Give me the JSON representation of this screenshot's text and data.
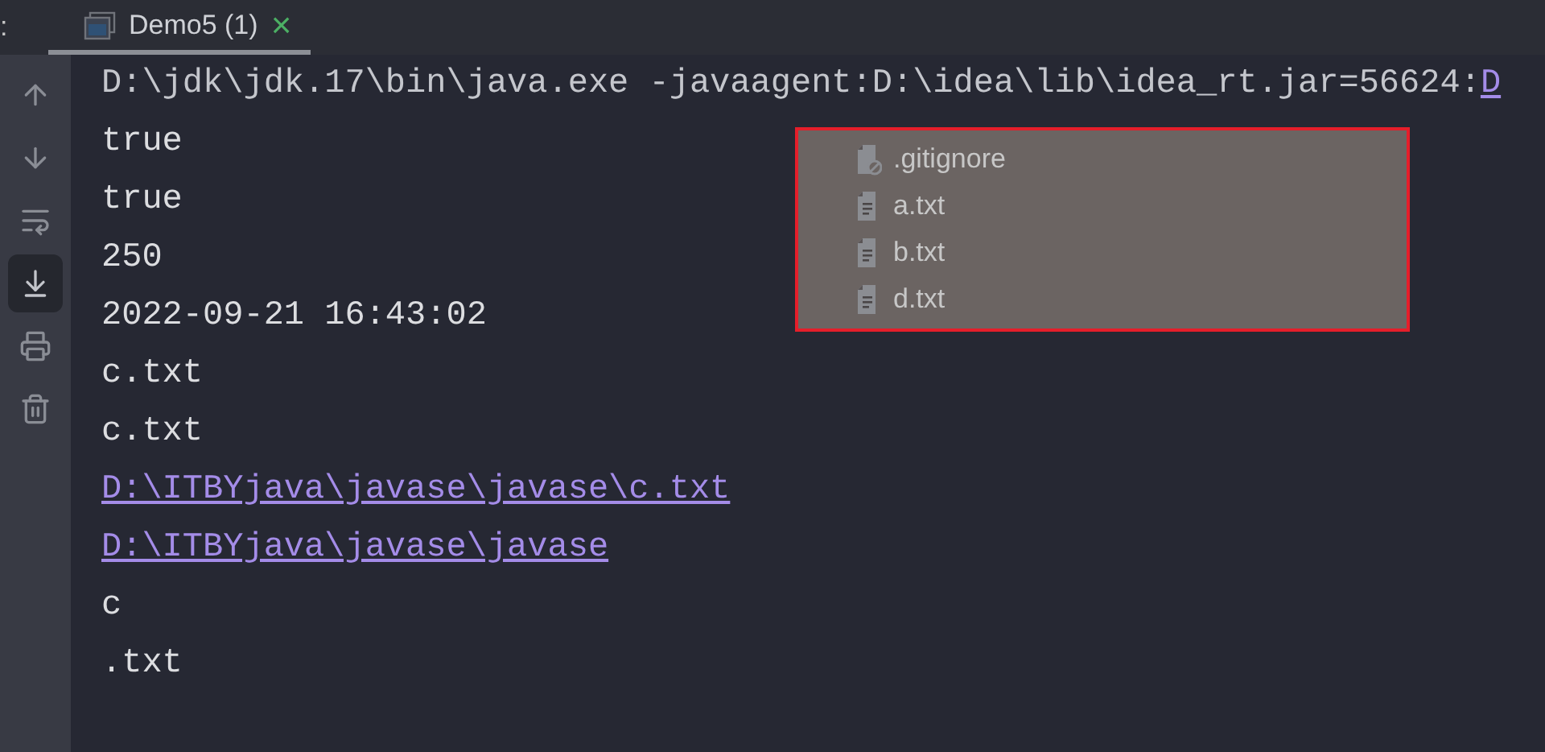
{
  "tab_bar": {
    "left_label": ":",
    "tab": {
      "title": "Demo5 (1)",
      "close": "×",
      "selected": true
    }
  },
  "toolbar": [
    {
      "kind": "up",
      "selected": false
    },
    {
      "kind": "down",
      "selected": false
    },
    {
      "kind": "wrap",
      "selected": false
    },
    {
      "kind": "scroll_end",
      "selected": true
    },
    {
      "kind": "print",
      "selected": false
    },
    {
      "kind": "clear",
      "selected": false
    }
  ],
  "console_lines": [
    {
      "kind": "command",
      "text": "D:\\jdk\\jdk.17\\bin\\java.exe -javaagent:D:\\idea\\lib\\idea_rt.jar=56624:",
      "link": "D"
    },
    {
      "kind": "plain",
      "text": "true"
    },
    {
      "kind": "plain",
      "text": "true"
    },
    {
      "kind": "plain",
      "text": "250"
    },
    {
      "kind": "plain",
      "text": "2022-09-21 16:43:02"
    },
    {
      "kind": "plain",
      "text": "c.txt"
    },
    {
      "kind": "plain",
      "text": "c.txt"
    },
    {
      "kind": "link",
      "text": "D:\\ITBYjava\\javase\\javase\\c.txt"
    },
    {
      "kind": "link",
      "text": "D:\\ITBYjava\\javase\\javase"
    },
    {
      "kind": "plain",
      "text": "c"
    },
    {
      "kind": "plain",
      "text": ".txt"
    }
  ],
  "file_list": [
    {
      "kind": "ignored",
      "name": ".gitignore"
    },
    {
      "kind": "text",
      "name": "a.txt"
    },
    {
      "kind": "text",
      "name": "b.txt"
    },
    {
      "kind": "text",
      "name": "d.txt"
    }
  ]
}
